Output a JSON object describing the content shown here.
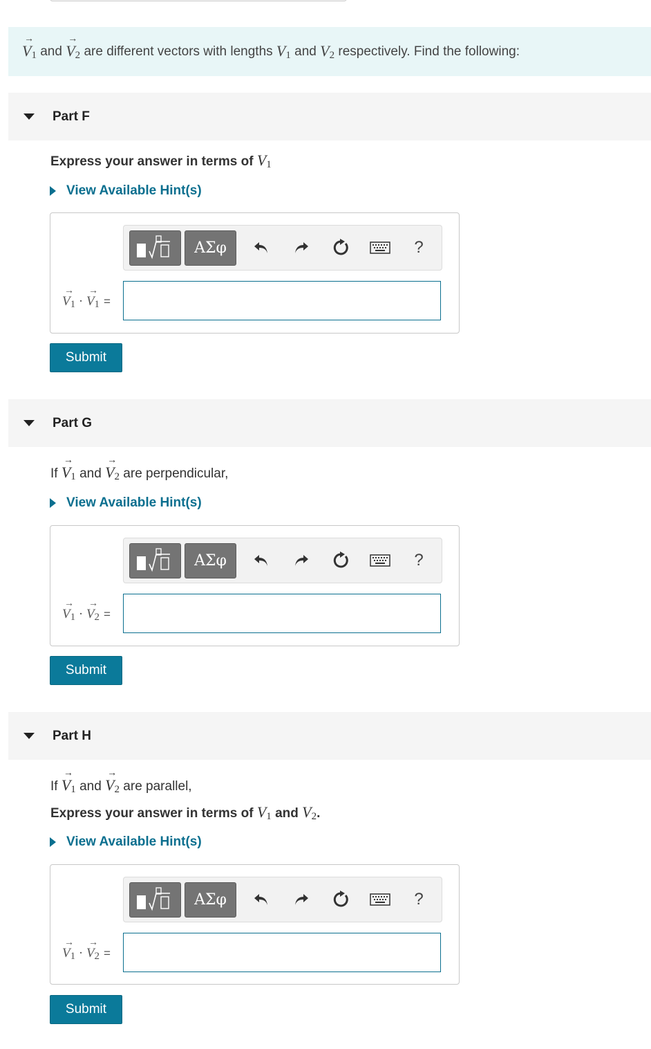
{
  "intro": {
    "v1": "V",
    "v1_sub": "1",
    "and1": "and",
    "v2": "V",
    "v2_sub": "2",
    "text_mid": "are different vectors with lengths",
    "len1": "V",
    "len1_sub": "1",
    "and2": "and",
    "len2": "V",
    "len2_sub": "2",
    "text_end": "respectively. Find the following:"
  },
  "toolbar": {
    "greek_label": "ΑΣφ",
    "help_label": "?"
  },
  "hint_label": "View Available Hint(s)",
  "submit_label": "Submit",
  "parts": [
    {
      "title": "Part F",
      "instruction_prefix": "Express your answer in terms of",
      "instruction_var": "V",
      "instruction_var_sub": "1",
      "lhs_a": "V",
      "lhs_a_sub": "1",
      "lhs_dot": "·",
      "lhs_b": "V",
      "lhs_b_sub": "1",
      "lhs_eq": "=",
      "answer_value": ""
    },
    {
      "title": "Part G",
      "condition_prefix": "If",
      "condition_mid": "and",
      "condition_end": "are perpendicular,",
      "lhs_a": "V",
      "lhs_a_sub": "1",
      "lhs_dot": "·",
      "lhs_b": "V",
      "lhs_b_sub": "2",
      "lhs_eq": "=",
      "answer_value": ""
    },
    {
      "title": "Part H",
      "condition_prefix": "If",
      "condition_mid": "and",
      "condition_end": "are parallel,",
      "instruction_prefix": "Express your answer in terms of",
      "instruction_and": "and",
      "instruction_period": ".",
      "lhs_a": "V",
      "lhs_a_sub": "1",
      "lhs_dot": "·",
      "lhs_b": "V",
      "lhs_b_sub": "2",
      "lhs_eq": "=",
      "answer_value": ""
    }
  ],
  "colors": {
    "accent": "#0b7a9a",
    "intro_bg": "#e8f6f7",
    "header_bg": "#f5f5f5"
  }
}
